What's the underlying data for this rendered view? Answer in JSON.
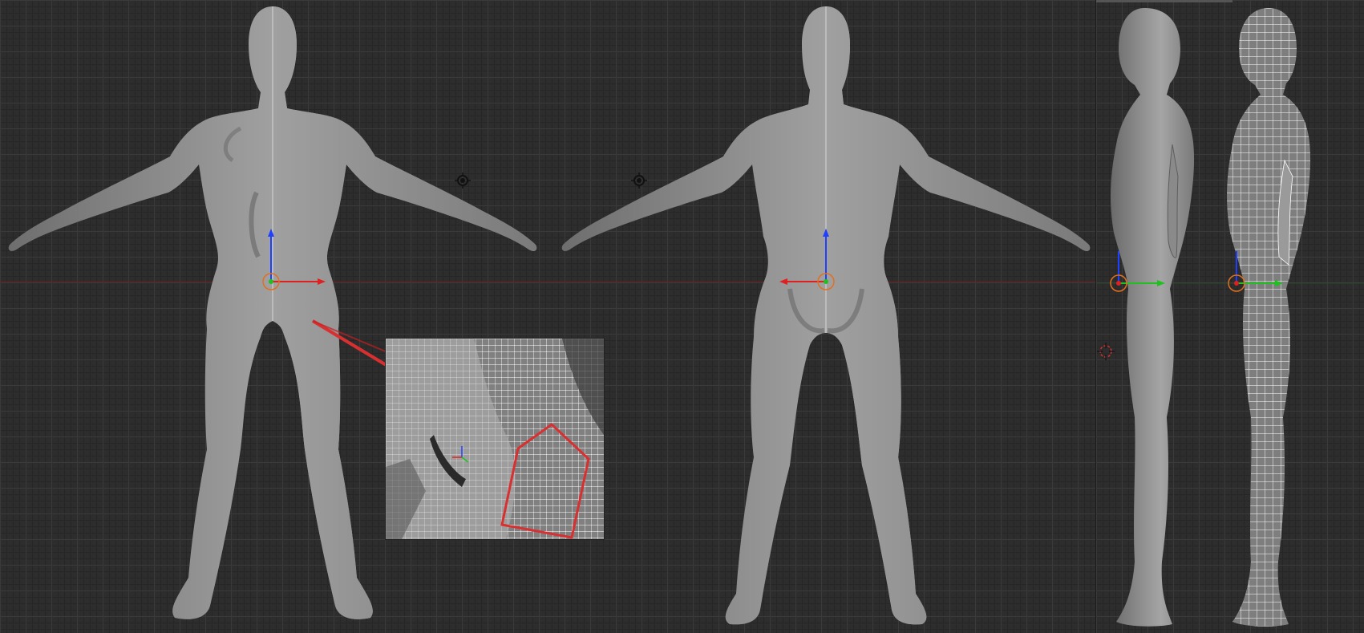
{
  "viewports": [
    {
      "id": "front-back",
      "views": [
        "front",
        "back"
      ]
    },
    {
      "id": "side",
      "views": [
        "side-solid",
        "side-wireframe"
      ]
    }
  ],
  "colors": {
    "grid_bg": "#2d2d2d",
    "mesh": "#8a8a8a",
    "wire": "#ffffff",
    "x_axis": "#e02020",
    "y_axis": "#20c020",
    "z_axis": "#2040ff",
    "highlight": "#d83030"
  },
  "icons": [
    "lamp-icon",
    "3d-cursor-icon",
    "transform-gizmo-icon"
  ],
  "inset": {
    "label": ""
  }
}
